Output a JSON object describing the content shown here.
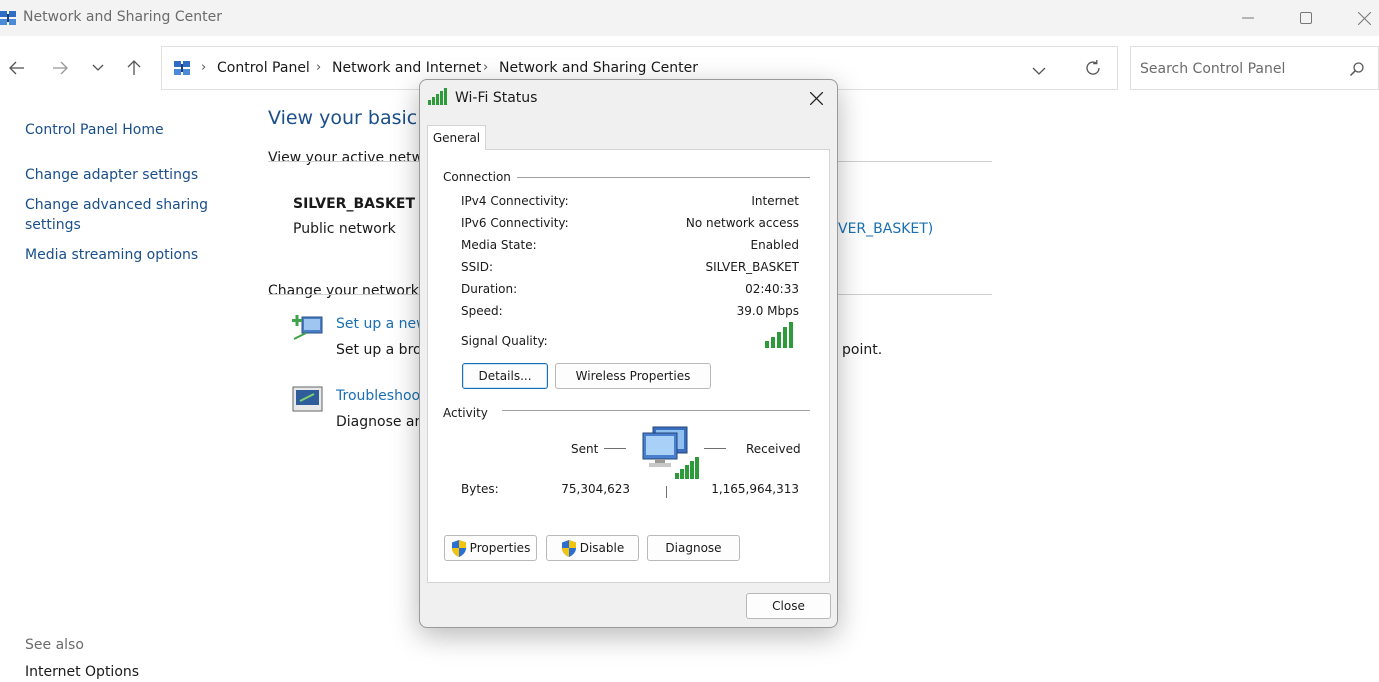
{
  "window": {
    "title": "Network and Sharing Center",
    "minimize_icon": "minimize-icon",
    "maximize_icon": "maximize-icon",
    "close_icon": "close-icon"
  },
  "nav": {
    "back_icon": "back-arrow-icon",
    "forward_icon": "forward-arrow-icon",
    "recent_icon": "chevron-down-icon",
    "up_icon": "up-arrow-icon"
  },
  "address": {
    "crumbs": [
      "Control Panel",
      "Network and Internet",
      "Network and Sharing Center"
    ],
    "dropdown_icon": "chevron-down-icon",
    "refresh_icon": "refresh-icon"
  },
  "search": {
    "placeholder": "Search Control Panel",
    "icon": "search-icon"
  },
  "sidebar": {
    "items": [
      {
        "label": "Control Panel Home"
      },
      {
        "label": "Change adapter settings"
      },
      {
        "label": "Change advanced sharing settings"
      },
      {
        "label": "Media streaming options"
      }
    ],
    "see_also": "See also",
    "see_also_items": [
      {
        "label": "Internet Options"
      }
    ]
  },
  "main": {
    "title": "View your basic n",
    "active_networks": "View your active netwo",
    "network_name": "SILVER_BASKET",
    "network_type": "Public network",
    "connection_link": "VER_BASKET)",
    "change_settings": "Change your networkin",
    "setup_link": "Set up a new",
    "setup_desc": "Set up a broa",
    "setup_desc_tail": "point.",
    "troubleshoot_link": "Troubleshoo",
    "troubleshoot_desc": "Diagnose an"
  },
  "dialog": {
    "title": "Wi-Fi Status",
    "tab": "General",
    "connection_group": "Connection",
    "rows": [
      {
        "label": "IPv4 Connectivity:",
        "value": "Internet"
      },
      {
        "label": "IPv6 Connectivity:",
        "value": "No network access"
      },
      {
        "label": "Media State:",
        "value": "Enabled"
      },
      {
        "label": "SSID:",
        "value": "SILVER_BASKET"
      },
      {
        "label": "Duration:",
        "value": "02:40:33"
      },
      {
        "label": "Speed:",
        "value": "39.0 Mbps"
      }
    ],
    "signal_label": "Signal Quality:",
    "signal_bars": 5,
    "details_button": "Details...",
    "wireless_button": "Wireless Properties",
    "activity_group": "Activity",
    "sent_label": "Sent",
    "received_label": "Received",
    "bytes_label": "Bytes:",
    "bytes_sent": "75,304,623",
    "bytes_received": "1,165,964,313",
    "properties_button": "Properties",
    "disable_button": "Disable",
    "diagnose_button": "Diagnose",
    "close_button": "Close"
  },
  "colors": {
    "link": "#1a6fb0",
    "title_link": "#1a4f8a",
    "signal_green": "#2e9b3a",
    "dialog_bg": "#f0f0f0"
  }
}
